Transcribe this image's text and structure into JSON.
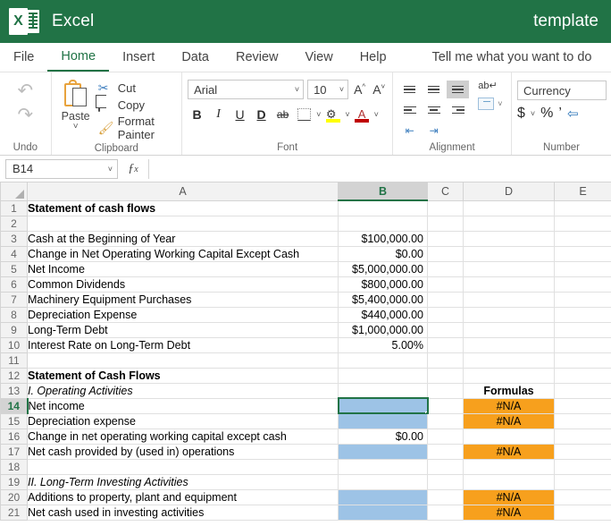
{
  "title_bar": {
    "app_name": "Excel",
    "document_name": "template",
    "logo_letter": "X",
    "brand_color": "#217346"
  },
  "tabs": [
    {
      "label": "File",
      "active": false
    },
    {
      "label": "Home",
      "active": true
    },
    {
      "label": "Insert",
      "active": false
    },
    {
      "label": "Data",
      "active": false
    },
    {
      "label": "Review",
      "active": false
    },
    {
      "label": "View",
      "active": false
    },
    {
      "label": "Help",
      "active": false
    }
  ],
  "tell_me": "Tell me what you want to do",
  "ribbon": {
    "undo": {
      "group_label": "Undo",
      "undo_icon": "undo-arrow",
      "redo_icon": "redo-arrow"
    },
    "clipboard": {
      "group_label": "Clipboard",
      "paste_label": "Paste",
      "cut_label": "Cut",
      "copy_label": "Copy",
      "format_painter_label": "Format Painter"
    },
    "font": {
      "group_label": "Font",
      "font_name": "Arial",
      "font_size": "10",
      "grow_font": "A",
      "shrink_font": "A",
      "bold": "B",
      "italic": "I",
      "underline": "U",
      "double_underline": "D",
      "strikethrough": "ab",
      "highlight_color": "#ffff00",
      "font_color": "#c00000"
    },
    "alignment": {
      "group_label": "Alignment"
    },
    "number": {
      "group_label": "Number",
      "format": "Currency",
      "currency_symbol": "$",
      "percent_symbol": "%",
      "comma_symbol": "’"
    }
  },
  "formula_bar": {
    "name_box": "B14",
    "fx_label": "fx",
    "formula_value": ""
  },
  "grid": {
    "columns": [
      "A",
      "B",
      "C",
      "D",
      "E"
    ],
    "selected_cell": "B14",
    "selected_column": "B",
    "selected_row": 14,
    "rows": [
      {
        "n": 1,
        "a": "Statement of cash flows",
        "a_style": "bold",
        "b": "",
        "c": "",
        "d": "",
        "d_style": ""
      },
      {
        "n": 2,
        "a": "",
        "a_style": "",
        "b": "",
        "c": "",
        "d": "",
        "d_style": ""
      },
      {
        "n": 3,
        "a": "Cash at the Beginning of Year",
        "a_style": "",
        "b": "$100,000.00",
        "c": "",
        "d": "",
        "d_style": ""
      },
      {
        "n": 4,
        "a": "Change in Net Operating Working Capital Except Cash",
        "a_style": "",
        "b": "$0.00",
        "c": "",
        "d": "",
        "d_style": ""
      },
      {
        "n": 5,
        "a": "Net Income",
        "a_style": "",
        "b": "$5,000,000.00",
        "c": "",
        "d": "",
        "d_style": ""
      },
      {
        "n": 6,
        "a": "Common Dividends",
        "a_style": "",
        "b": "$800,000.00",
        "c": "",
        "d": "",
        "d_style": ""
      },
      {
        "n": 7,
        "a": "Machinery Equipment Purchases",
        "a_style": "",
        "b": "$5,400,000.00",
        "c": "",
        "d": "",
        "d_style": ""
      },
      {
        "n": 8,
        "a": "Depreciation Expense",
        "a_style": "",
        "b": "$440,000.00",
        "c": "",
        "d": "",
        "d_style": ""
      },
      {
        "n": 9,
        "a": "Long-Term Debt",
        "a_style": "",
        "b": "$1,000,000.00",
        "c": "",
        "d": "",
        "d_style": ""
      },
      {
        "n": 10,
        "a": "Interest Rate on Long-Term Debt",
        "a_style": "",
        "b": "5.00%",
        "c": "",
        "d": "",
        "d_style": ""
      },
      {
        "n": 11,
        "a": "",
        "a_style": "",
        "b": "",
        "c": "",
        "d": "",
        "d_style": ""
      },
      {
        "n": 12,
        "a": "Statement of Cash Flows",
        "a_style": "bold",
        "b": "",
        "c": "",
        "d": "",
        "d_style": ""
      },
      {
        "n": 13,
        "a": "I.  Operating Activities",
        "a_style": "ital",
        "b": "",
        "c": "",
        "d": "Formulas",
        "d_style": "bold"
      },
      {
        "n": 14,
        "a": "Net income",
        "a_style": "ind1",
        "b": "",
        "b_fill": "blue",
        "c": "",
        "d": "#N/A",
        "d_style": "orange"
      },
      {
        "n": 15,
        "a": "Depreciation expense",
        "a_style": "ind1",
        "b": "",
        "b_fill": "blue",
        "c": "",
        "d": "#N/A",
        "d_style": "orange"
      },
      {
        "n": 16,
        "a": "Change in net operating working capital except cash",
        "a_style": "ind1",
        "b": "$0.00",
        "c": "",
        "d": "",
        "d_style": ""
      },
      {
        "n": 17,
        "a": "Net cash provided by (used in) operations",
        "a_style": "ind2",
        "b": "",
        "b_fill": "blue",
        "b_top": true,
        "c": "",
        "d": "#N/A",
        "d_style": "orange",
        "d_top": true
      },
      {
        "n": 18,
        "a": "",
        "a_style": "",
        "b": "",
        "c": "",
        "d": "",
        "d_style": ""
      },
      {
        "n": 19,
        "a": "II.  Long-Term Investing Activities",
        "a_style": "ital",
        "b": "",
        "c": "",
        "d": "",
        "d_style": ""
      },
      {
        "n": 20,
        "a": "Additions to property, plant and equipment",
        "a_style": "ind1",
        "b": "",
        "b_fill": "blue",
        "c": "",
        "d": "#N/A",
        "d_style": "orange"
      },
      {
        "n": 21,
        "a": "Net cash used in investing activities",
        "a_style": "ind2",
        "b": "",
        "b_fill": "blue",
        "b_top": true,
        "c": "",
        "d": "#N/A",
        "d_style": "orange",
        "d_top": true
      }
    ]
  },
  "colors": {
    "cell_fill_blue": "#9dc3e6",
    "cell_fill_orange": "#f7a01d",
    "selection_green": "#217346"
  }
}
